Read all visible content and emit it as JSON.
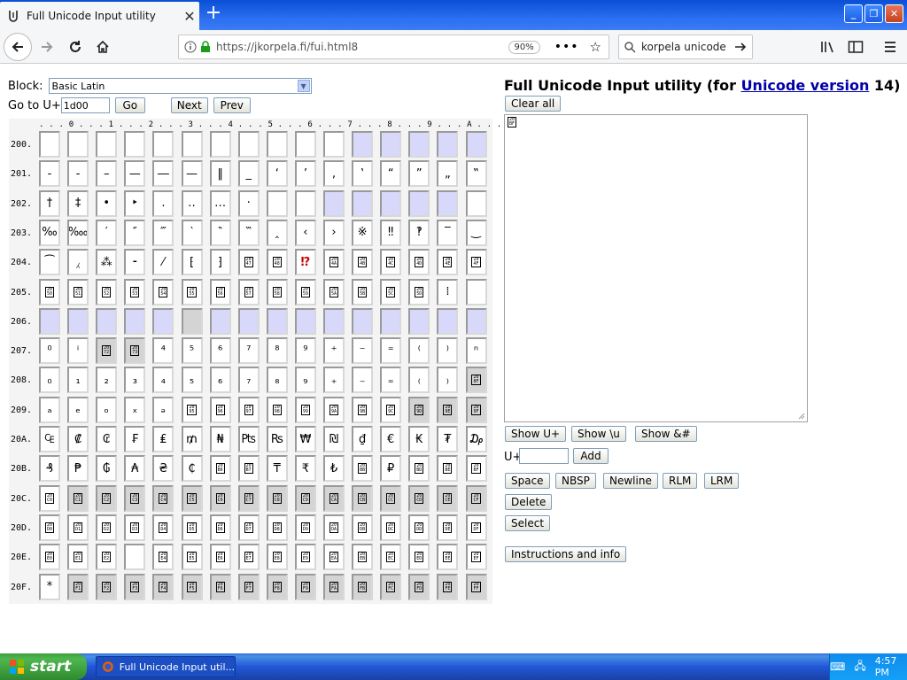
{
  "browser": {
    "tab_title": "Full Unicode Input utility",
    "tab_close": "✕",
    "new_tab": "+",
    "url": "https://jkorpela.fi/fui.html8",
    "zoom": "90%",
    "search_text": "korpela unicode",
    "window_buttons": [
      "_",
      "❐",
      "✕"
    ]
  },
  "left": {
    "block_label": "Block:",
    "block_value": "Basic Latin",
    "goto_label": "Go to U+",
    "goto_value": "1d00",
    "go_button": "Go",
    "next_button": "Next",
    "prev_button": "Prev",
    "col_header": ". . . 0 . . . 1 . . . 2 . . . 3 . . . 4 . . . 5 . . . 6 . . . 7 . . . 8 . . . 9 . . . A . . . B . . . C . . . D . . . E . . . F"
  },
  "grid": {
    "rows": [
      {
        "label": "200.",
        "cells": [
          [
            "",
            ""
          ],
          [
            "",
            ""
          ],
          [
            "",
            ""
          ],
          [
            "",
            ""
          ],
          [
            "",
            ""
          ],
          [
            "",
            ""
          ],
          [
            "",
            ""
          ],
          [
            "",
            ""
          ],
          [
            "",
            ""
          ],
          [
            "",
            ""
          ],
          [
            "",
            ""
          ],
          [
            "",
            "u"
          ],
          [
            "",
            "u"
          ],
          [
            "",
            "u"
          ],
          [
            "",
            "u"
          ],
          [
            "",
            "u"
          ]
        ]
      },
      {
        "label": "201.",
        "cells": [
          [
            "-",
            ""
          ],
          [
            "-",
            ""
          ],
          [
            "–",
            ""
          ],
          [
            "—",
            ""
          ],
          [
            "―",
            ""
          ],
          [
            "—",
            ""
          ],
          [
            "‖",
            ""
          ],
          [
            "_",
            ""
          ],
          [
            "‘",
            ""
          ],
          [
            "’",
            ""
          ],
          [
            "‚",
            ""
          ],
          [
            "‛",
            ""
          ],
          [
            "“",
            ""
          ],
          [
            "”",
            ""
          ],
          [
            "„",
            ""
          ],
          [
            "‟",
            ""
          ]
        ]
      },
      {
        "label": "202.",
        "cells": [
          [
            "†",
            ""
          ],
          [
            "‡",
            ""
          ],
          [
            "•",
            ""
          ],
          [
            "‣",
            ""
          ],
          [
            "․",
            ""
          ],
          [
            "‥",
            ""
          ],
          [
            "…",
            ""
          ],
          [
            "‧",
            ""
          ],
          [
            "",
            ""
          ],
          [
            "",
            ""
          ],
          [
            "",
            "u"
          ],
          [
            "",
            "u"
          ],
          [
            "",
            "u"
          ],
          [
            "",
            "u"
          ],
          [
            "",
            "u"
          ],
          [
            "",
            ""
          ]
        ]
      },
      {
        "label": "203.",
        "cells": [
          [
            "‰",
            ""
          ],
          [
            "‱",
            ""
          ],
          [
            "′",
            ""
          ],
          [
            "″",
            ""
          ],
          [
            "‴",
            ""
          ],
          [
            "‵",
            ""
          ],
          [
            "‶",
            ""
          ],
          [
            "‷",
            ""
          ],
          [
            "‸",
            ""
          ],
          [
            "‹",
            ""
          ],
          [
            "›",
            ""
          ],
          [
            "※",
            ""
          ],
          [
            "‼",
            ""
          ],
          [
            "‽",
            ""
          ],
          [
            "‾",
            ""
          ],
          [
            "‿",
            ""
          ]
        ]
      },
      {
        "label": "204.",
        "cells": [
          [
            "⁀",
            ""
          ],
          [
            "⁁",
            ""
          ],
          [
            "⁂",
            ""
          ],
          [
            "⁃",
            ""
          ],
          [
            "⁄",
            ""
          ],
          [
            "⁅",
            ""
          ],
          [
            "⁆",
            ""
          ],
          [
            "2047",
            "b"
          ],
          [
            "2048",
            "b"
          ],
          [
            "⁉",
            "r"
          ],
          [
            "204A",
            "b"
          ],
          [
            "204B",
            "b"
          ],
          [
            "204C",
            "b"
          ],
          [
            "204D",
            "b"
          ],
          [
            "204E",
            "b"
          ],
          [
            "204F",
            "b"
          ]
        ]
      },
      {
        "label": "205.",
        "cells": [
          [
            "2050",
            "b"
          ],
          [
            "2051",
            "b"
          ],
          [
            "2052",
            "b"
          ],
          [
            "2053",
            "b"
          ],
          [
            "2054",
            "b"
          ],
          [
            "2055",
            "b"
          ],
          [
            "2056",
            "b"
          ],
          [
            "2057",
            "b"
          ],
          [
            "2058",
            "b"
          ],
          [
            "2059",
            "b"
          ],
          [
            "205A",
            "b"
          ],
          [
            "205B",
            "b"
          ],
          [
            "205C",
            "b"
          ],
          [
            "205D",
            "b"
          ],
          [
            "⁞",
            ""
          ],
          [
            "",
            ""
          ]
        ]
      },
      {
        "label": "206.",
        "cells": [
          [
            "",
            "u"
          ],
          [
            "",
            "u"
          ],
          [
            "",
            "u"
          ],
          [
            "",
            "u"
          ],
          [
            "",
            "u"
          ],
          [
            "",
            "g"
          ],
          [
            "",
            "u"
          ],
          [
            "",
            "u"
          ],
          [
            "",
            "u"
          ],
          [
            "",
            "u"
          ],
          [
            "",
            "u"
          ],
          [
            "",
            "u"
          ],
          [
            "",
            "u"
          ],
          [
            "",
            "u"
          ],
          [
            "",
            "u"
          ],
          [
            "",
            "u"
          ]
        ]
      },
      {
        "label": "207.",
        "cells": [
          [
            "⁰",
            ""
          ],
          [
            "ⁱ",
            ""
          ],
          [
            "2072",
            "bg"
          ],
          [
            "2073",
            "bg"
          ],
          [
            "⁴",
            ""
          ],
          [
            "⁵",
            ""
          ],
          [
            "⁶",
            ""
          ],
          [
            "⁷",
            ""
          ],
          [
            "⁸",
            ""
          ],
          [
            "⁹",
            ""
          ],
          [
            "⁺",
            ""
          ],
          [
            "⁻",
            ""
          ],
          [
            "⁼",
            ""
          ],
          [
            "⁽",
            ""
          ],
          [
            "⁾",
            ""
          ],
          [
            "ⁿ",
            ""
          ]
        ]
      },
      {
        "label": "208.",
        "cells": [
          [
            "₀",
            ""
          ],
          [
            "₁",
            ""
          ],
          [
            "₂",
            ""
          ],
          [
            "₃",
            ""
          ],
          [
            "₄",
            ""
          ],
          [
            "₅",
            ""
          ],
          [
            "₆",
            ""
          ],
          [
            "₇",
            ""
          ],
          [
            "₈",
            ""
          ],
          [
            "₉",
            ""
          ],
          [
            "₊",
            ""
          ],
          [
            "₋",
            ""
          ],
          [
            "₌",
            ""
          ],
          [
            "₍",
            ""
          ],
          [
            "₎",
            ""
          ],
          [
            "208F",
            "bg"
          ]
        ]
      },
      {
        "label": "209.",
        "cells": [
          [
            "ₐ",
            ""
          ],
          [
            "ₑ",
            ""
          ],
          [
            "ₒ",
            ""
          ],
          [
            "ₓ",
            ""
          ],
          [
            "ₔ",
            ""
          ],
          [
            "2095",
            "b"
          ],
          [
            "2096",
            "b"
          ],
          [
            "2097",
            "b"
          ],
          [
            "2098",
            "b"
          ],
          [
            "2099",
            "b"
          ],
          [
            "209A",
            "b"
          ],
          [
            "209B",
            "b"
          ],
          [
            "209C",
            "b"
          ],
          [
            "209D",
            "bg"
          ],
          [
            "209E",
            "bg"
          ],
          [
            "209F",
            "bg"
          ]
        ]
      },
      {
        "label": "20A.",
        "cells": [
          [
            "₠",
            ""
          ],
          [
            "₡",
            ""
          ],
          [
            "₢",
            ""
          ],
          [
            "₣",
            ""
          ],
          [
            "₤",
            ""
          ],
          [
            "₥",
            ""
          ],
          [
            "₦",
            ""
          ],
          [
            "₧",
            ""
          ],
          [
            "₨",
            ""
          ],
          [
            "₩",
            ""
          ],
          [
            "₪",
            ""
          ],
          [
            "₫",
            ""
          ],
          [
            "€",
            ""
          ],
          [
            "₭",
            ""
          ],
          [
            "₮",
            ""
          ],
          [
            "₯",
            ""
          ]
        ]
      },
      {
        "label": "20B.",
        "cells": [
          [
            "₰",
            ""
          ],
          [
            "₱",
            ""
          ],
          [
            "₲",
            ""
          ],
          [
            "₳",
            ""
          ],
          [
            "₴",
            ""
          ],
          [
            "₵",
            ""
          ],
          [
            "20B6",
            "b"
          ],
          [
            "20B7",
            "b"
          ],
          [
            "₸",
            ""
          ],
          [
            "₹",
            ""
          ],
          [
            "₺",
            ""
          ],
          [
            "20BB",
            "b"
          ],
          [
            "₽",
            ""
          ],
          [
            "20BD",
            "b"
          ],
          [
            "20BE",
            "b"
          ],
          [
            "20BF",
            "b"
          ]
        ]
      },
      {
        "label": "20C.",
        "cells": [
          [
            "20C0",
            "b"
          ],
          [
            "20C1",
            "bg"
          ],
          [
            "20C2",
            "bg"
          ],
          [
            "20C3",
            "bg"
          ],
          [
            "20C4",
            "bg"
          ],
          [
            "20C5",
            "bg"
          ],
          [
            "20C6",
            "bg"
          ],
          [
            "20C7",
            "bg"
          ],
          [
            "20C8",
            "bg"
          ],
          [
            "20C9",
            "bg"
          ],
          [
            "20CA",
            "bg"
          ],
          [
            "20CB",
            "bg"
          ],
          [
            "20CC",
            "bg"
          ],
          [
            "20CD",
            "bg"
          ],
          [
            "20CE",
            "bg"
          ],
          [
            "20CF",
            "bg"
          ]
        ]
      },
      {
        "label": "20D.",
        "cells": [
          [
            "20D0",
            "b"
          ],
          [
            "20D1",
            "b"
          ],
          [
            "20D2",
            "b"
          ],
          [
            "20D3",
            "b"
          ],
          [
            "20D4",
            "b"
          ],
          [
            "20D5",
            "b"
          ],
          [
            "20D6",
            "b"
          ],
          [
            "20D7",
            "b"
          ],
          [
            "20D8",
            "b"
          ],
          [
            "20D9",
            "b"
          ],
          [
            "20DA",
            "b"
          ],
          [
            "20DB",
            "b"
          ],
          [
            "20DC",
            "b"
          ],
          [
            "20DD",
            "b"
          ],
          [
            "20DE",
            "b"
          ],
          [
            "20DF",
            "b"
          ]
        ]
      },
      {
        "label": "20E.",
        "cells": [
          [
            "20E0",
            "b"
          ],
          [
            "20E1",
            "b"
          ],
          [
            "20E2",
            "b"
          ],
          [
            "",
            ""
          ],
          [
            "20E4",
            "b"
          ],
          [
            "20E5",
            "b"
          ],
          [
            "20E6",
            "b"
          ],
          [
            "20E7",
            "b"
          ],
          [
            "20E8",
            "b"
          ],
          [
            "20E9",
            "b"
          ],
          [
            "20EA",
            "b"
          ],
          [
            "20EB",
            "b"
          ],
          [
            "20EC",
            "b"
          ],
          [
            "20ED",
            "b"
          ],
          [
            "20EE",
            "b"
          ],
          [
            "20EF",
            "b"
          ]
        ]
      },
      {
        "label": "20F.",
        "cells": [
          [
            "*",
            ""
          ],
          [
            "20F1",
            "bg"
          ],
          [
            "20F2",
            "bg"
          ],
          [
            "20F3",
            "bg"
          ],
          [
            "20F4",
            "bg"
          ],
          [
            "20F5",
            "bg"
          ],
          [
            "20F6",
            "bg"
          ],
          [
            "20F7",
            "bg"
          ],
          [
            "20F8",
            "bg"
          ],
          [
            "20F9",
            "bg"
          ],
          [
            "20FA",
            "bg"
          ],
          [
            "20FB",
            "bg"
          ],
          [
            "20FC",
            "bg"
          ],
          [
            "20FD",
            "bg"
          ],
          [
            "20FE",
            "bg"
          ],
          [
            "20FF",
            "bg"
          ]
        ]
      }
    ]
  },
  "right": {
    "title_prefix": "Full Unicode Input utility (for ",
    "title_link": "Unicode version",
    "title_suffix": " 14)",
    "clear_all": "Clear all",
    "textarea_box": "20BF",
    "show_u": "Show U+",
    "show_backslash": "Show \\u",
    "show_amp": "Show &#",
    "uplus_label": "U+",
    "add_button": "Add",
    "space": "Space",
    "nbsp": "NBSP",
    "newline": "Newline",
    "rlm": "RLM",
    "lrm": "LRM",
    "delete": "Delete",
    "select": "Select",
    "instructions": "Instructions and info"
  },
  "taskbar": {
    "start": "start",
    "task_label": "Full Unicode Input util...",
    "clock": "4:57 PM"
  }
}
